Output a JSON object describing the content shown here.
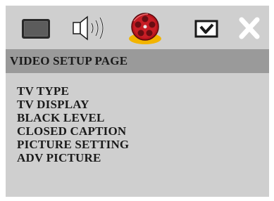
{
  "toolbar": {
    "items": [
      {
        "icon": "general-setup-icon"
      },
      {
        "icon": "audio-setup-icon"
      },
      {
        "icon": "video-setup-icon",
        "selected": true
      },
      {
        "icon": "preference-setup-icon"
      },
      {
        "icon": "exit-icon"
      }
    ]
  },
  "header": {
    "title": "VIDEO SETUP PAGE"
  },
  "menu": {
    "items": [
      {
        "label": "TV TYPE"
      },
      {
        "label": "TV DISPLAY"
      },
      {
        "label": "BLACK LEVEL"
      },
      {
        "label": "CLOSED CAPTION"
      },
      {
        "label": "PICTURE SETTING"
      },
      {
        "label": "ADV PICTURE"
      }
    ]
  },
  "colors": {
    "panel_bg": "#cfcfcf",
    "header_bg": "#9a9a9a",
    "text": "#1a1a1a",
    "selected_highlight": "#f2b400"
  }
}
